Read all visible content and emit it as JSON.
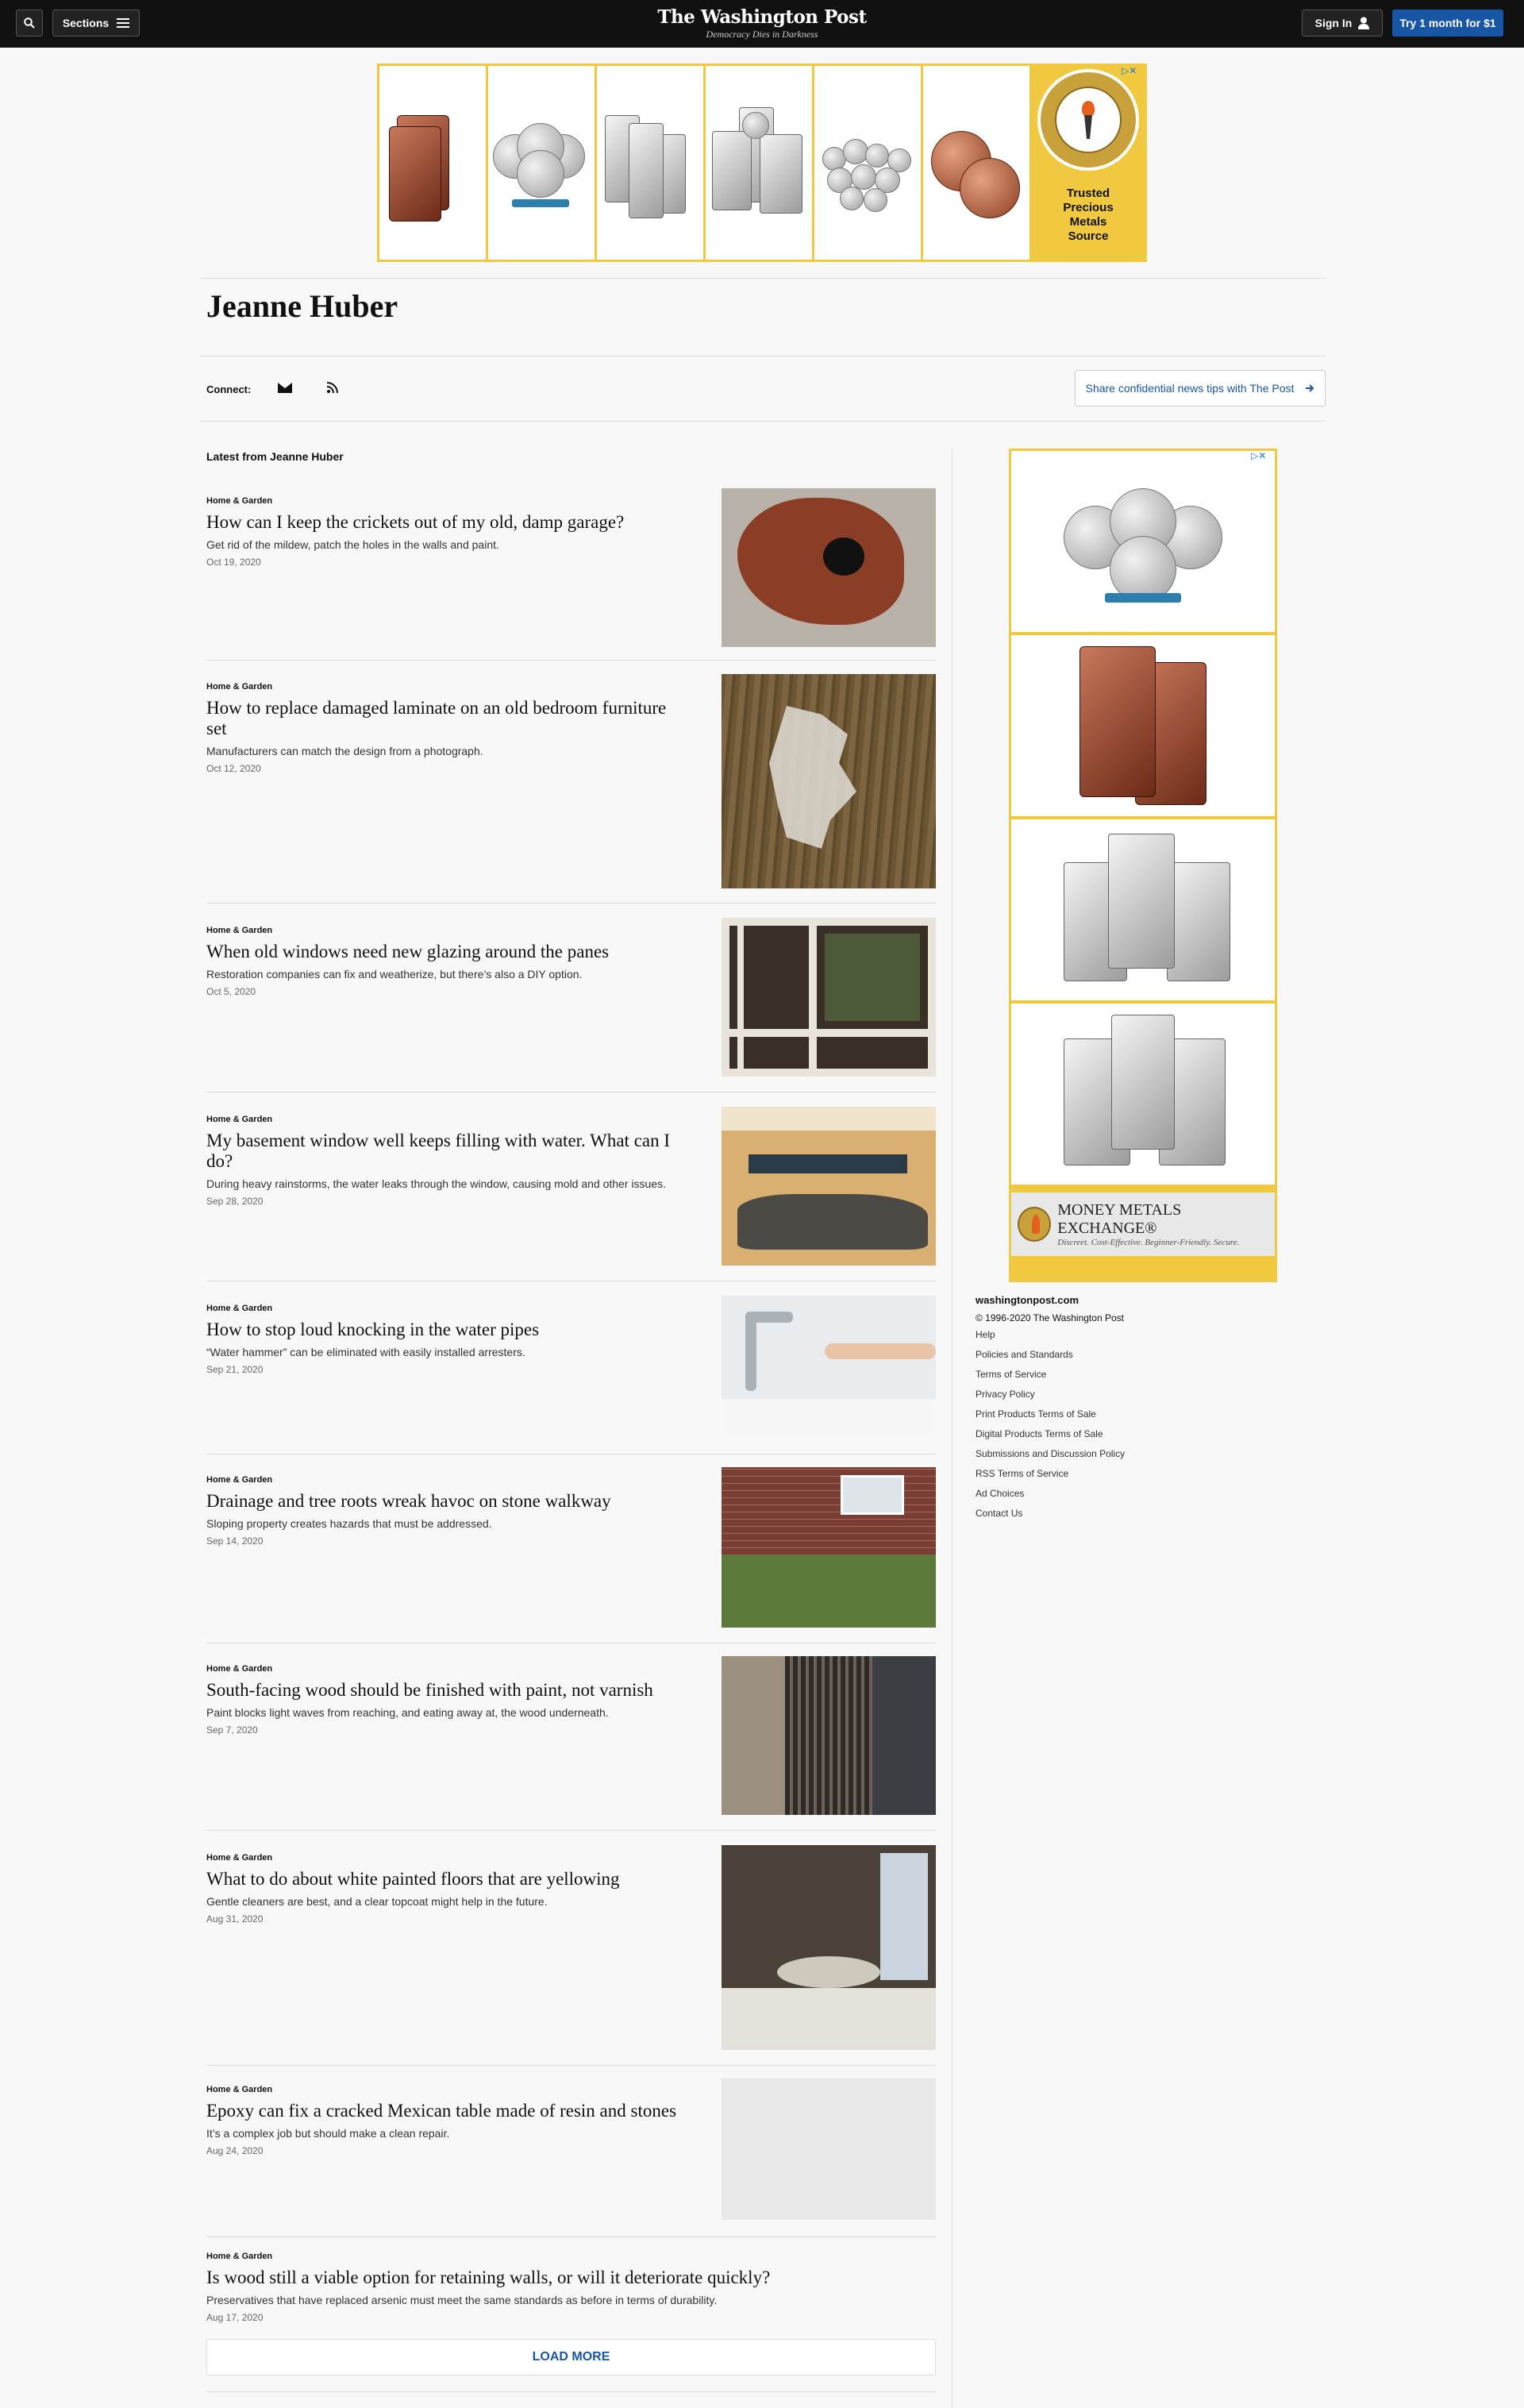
{
  "topbar": {
    "sections_label": "Sections",
    "logo": "The Washington Post",
    "tagline": "Democracy Dies in Darkness",
    "signin_label": "Sign In",
    "trial_label": "Try 1 month for $1"
  },
  "top_ad": {
    "brand_ring_text": "MONEY METALS EXCHANGE",
    "brand_text_lines": [
      "Trusted",
      "Precious",
      "Metals",
      "Source"
    ]
  },
  "author": {
    "name": "Jeanne Huber",
    "connect_label": "Connect:",
    "tips_label": "Share confidential news tips with The Post"
  },
  "feed": {
    "label": "Latest from Jeanne Huber",
    "load_more": "LOAD MORE",
    "stories": [
      {
        "kicker": "Home & Garden",
        "headline": "How can I keep the crickets out of my old, damp garage?",
        "blurb": "Get rid of the mildew, patch the holes in the walls and paint.",
        "date": "Oct 19, 2020"
      },
      {
        "kicker": "Home & Garden",
        "headline": "How to replace damaged laminate on an old bedroom furniture set",
        "blurb": "Manufacturers can match the design from a photograph.",
        "date": "Oct 12, 2020"
      },
      {
        "kicker": "Home & Garden",
        "headline": "When old windows need new glazing around the panes",
        "blurb": "Restoration companies can fix and weatherize, but there’s also a DIY option.",
        "date": "Oct 5, 2020"
      },
      {
        "kicker": "Home & Garden",
        "headline": "My basement window well keeps filling with water. What can I do?",
        "blurb": "During heavy rainstorms, the water leaks through the window, causing mold and other issues.",
        "date": "Sep 28, 2020"
      },
      {
        "kicker": "Home & Garden",
        "headline": "How to stop loud knocking in the water pipes",
        "blurb": "“Water hammer” can be eliminated with easily installed arresters.",
        "date": "Sep 21, 2020"
      },
      {
        "kicker": "Home & Garden",
        "headline": "Drainage and tree roots wreak havoc on stone walkway",
        "blurb": "Sloping property creates hazards that must be addressed.",
        "date": "Sep 14, 2020"
      },
      {
        "kicker": "Home & Garden",
        "headline": "South-facing wood should be finished with paint, not varnish",
        "blurb": "Paint blocks light waves from reaching, and eating away at, the wood underneath.",
        "date": "Sep 7, 2020"
      },
      {
        "kicker": "Home & Garden",
        "headline": "What to do about white painted floors that are yellowing",
        "blurb": "Gentle cleaners are best, and a clear topcoat might help in the future.",
        "date": "Aug 31, 2020"
      },
      {
        "kicker": "Home & Garden",
        "headline": "Epoxy can fix a cracked Mexican table made of resin and stones",
        "blurb": "It’s a complex job but should make a clean repair.",
        "date": "Aug 24, 2020"
      },
      {
        "kicker": "Home & Garden",
        "headline": "Is wood still a viable option for retaining walls, or will it deteriorate quickly?",
        "blurb": "Preservatives that have replaced arsenic must meet the same standards as before in terms of durability.",
        "date": "Aug 17, 2020"
      }
    ]
  },
  "side_ad": {
    "brand_name": "MONEY METALS EXCHANGE®",
    "brand_slogan": "Discreet. Cost-Effective. Beginner-Friendly. Secure."
  },
  "footer": {
    "site": "washingtonpost.com",
    "copyright": "© 1996-2020 The Washington Post",
    "links": [
      "Help",
      "Policies and Standards",
      "Terms of Service",
      "Privacy Policy",
      "Print Products Terms of Sale",
      "Digital Products Terms of Sale",
      "Submissions and Discussion Policy",
      "RSS Terms of Service",
      "Ad Choices",
      "Contact Us"
    ]
  },
  "colors": {
    "topbar_bg": "#111111",
    "accent_blue": "#1955a5",
    "ad_gold": "#f1c940"
  }
}
